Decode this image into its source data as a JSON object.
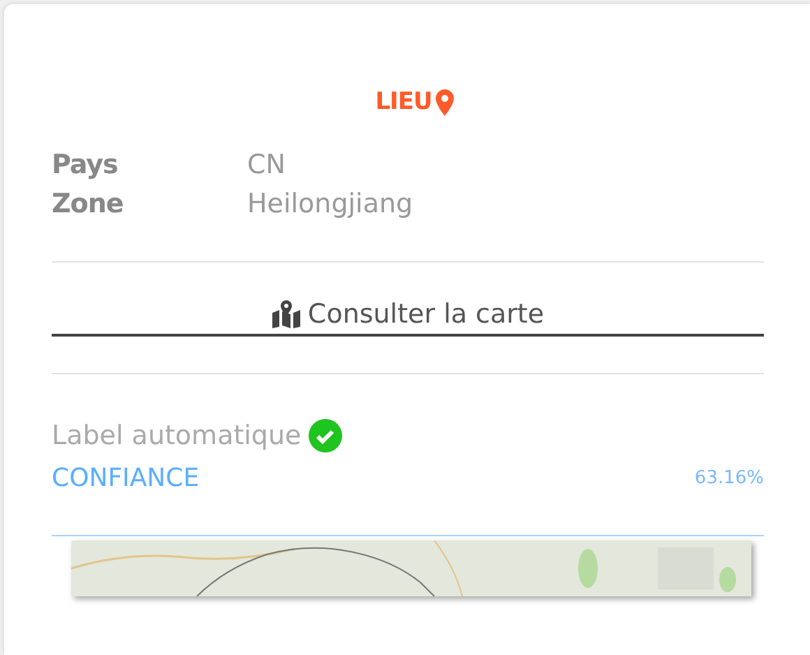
{
  "section": {
    "title": "LIEU"
  },
  "fields": [
    {
      "label": "Pays",
      "value": "CN"
    },
    {
      "label": "Zone",
      "value": "Heilongjiang"
    }
  ],
  "map_button": {
    "label": "Consulter la carte"
  },
  "auto_label": {
    "text": "Label automatique",
    "checked": true
  },
  "confidence": {
    "label": "CONFIANCE",
    "value": "63.16%"
  }
}
